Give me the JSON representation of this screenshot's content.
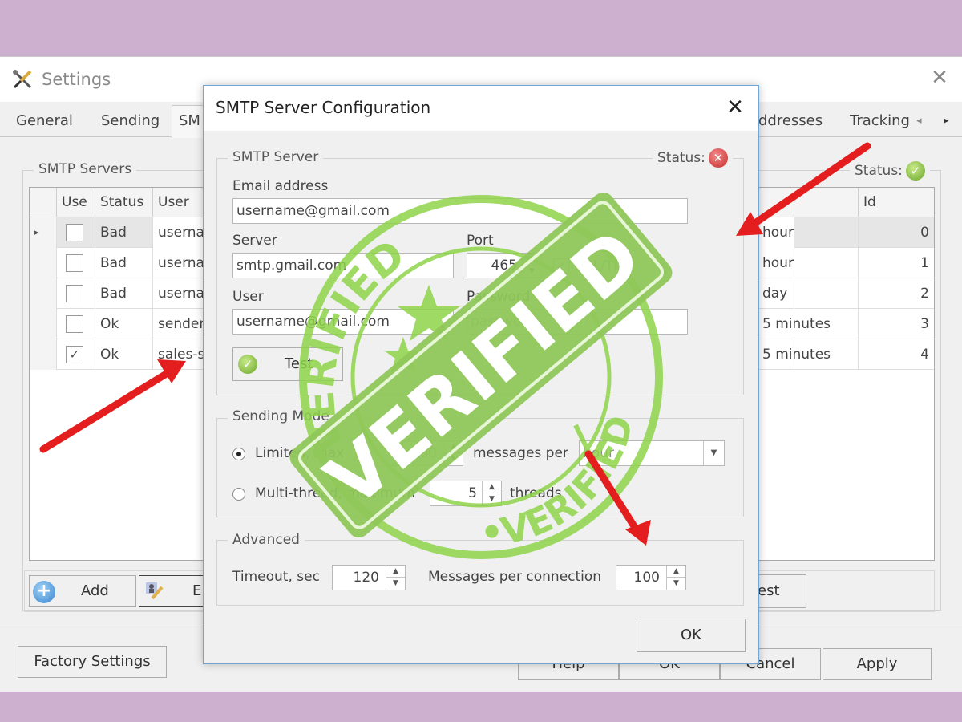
{
  "settings_window": {
    "title": "Settings",
    "close_glyph": "✕",
    "tabs": [
      {
        "label": "General"
      },
      {
        "label": "Sending"
      },
      {
        "label": "SM"
      },
      {
        "label": "ddresses"
      },
      {
        "label": "Tracking"
      }
    ],
    "tab_scroll_left": "◂",
    "tab_scroll_right": "▸",
    "smtp_servers_group": {
      "label": "SMTP Servers",
      "status_label": "Status:",
      "status_icon": "check-circle-icon",
      "columns": [
        "",
        "Use",
        "Status",
        "User",
        "",
        "Id"
      ],
      "rows": [
        {
          "marker": "▸",
          "use": false,
          "status": "Bad",
          "user": "userna",
          "period": "hour",
          "id": "0",
          "selected": true
        },
        {
          "marker": "",
          "use": false,
          "status": "Bad",
          "user": "userna",
          "period": "hour",
          "id": "1",
          "selected": false
        },
        {
          "marker": "",
          "use": false,
          "status": "Bad",
          "user": "userna",
          "period": "day",
          "id": "2",
          "selected": false
        },
        {
          "marker": "",
          "use": false,
          "status": "Ok",
          "user": "sender",
          "period": "5 minutes",
          "id": "3",
          "selected": false
        },
        {
          "marker": "",
          "use": true,
          "status": "Ok",
          "user": "sales-s",
          "period": "5 minutes",
          "id": "4",
          "selected": false
        }
      ],
      "check_glyph": "✓",
      "buttons": {
        "add": "Add",
        "edit": "E",
        "test": "est"
      }
    },
    "footer_buttons": {
      "factory_settings": "Factory Settings",
      "help": "Help",
      "ok": "OK",
      "cancel": "Cancel",
      "apply": "Apply"
    }
  },
  "dialog": {
    "title": "SMTP Server Configuration",
    "close_glyph": "✕",
    "smtp_server_group": {
      "label": "SMTP Server",
      "status_label": "Status:",
      "status_glyph": "✕",
      "email_label": "Email address",
      "email_value": "username@gmail.com",
      "server_label": "Server",
      "server_value": "smtp.gmail.com",
      "port_label": "Port",
      "port_value": "465",
      "ssl_label": "SSL/TLS",
      "ssl_checked": true,
      "user_label": "User",
      "user_value": "username@gmail.com",
      "password_label": "Password",
      "password_value": "password",
      "test_button": "Test"
    },
    "sending_mode_group": {
      "label": "Sending Mode",
      "limited_label": "Limited, max",
      "limited_selected": true,
      "limited_value": "500",
      "messages_per_label": "messages per",
      "period_value": "hour",
      "multithread_label": "Multi-thread, maximum",
      "multithread_selected": false,
      "threads_value": "5",
      "threads_label": "threads"
    },
    "advanced_group": {
      "label": "Advanced",
      "timeout_label": "Timeout, sec",
      "timeout_value": "120",
      "messages_per_connection_label": "Messages per connection",
      "messages_per_connection_value": "100"
    },
    "ok_button": "OK"
  },
  "stamp": {
    "main_text": "VERIFIED",
    "ring_text_top": "VERIFIED",
    "ring_text_bottom": "•VERIFIED",
    "color": "#8fd44a"
  },
  "annotations": {
    "arrow_color": "#e41e1e"
  }
}
